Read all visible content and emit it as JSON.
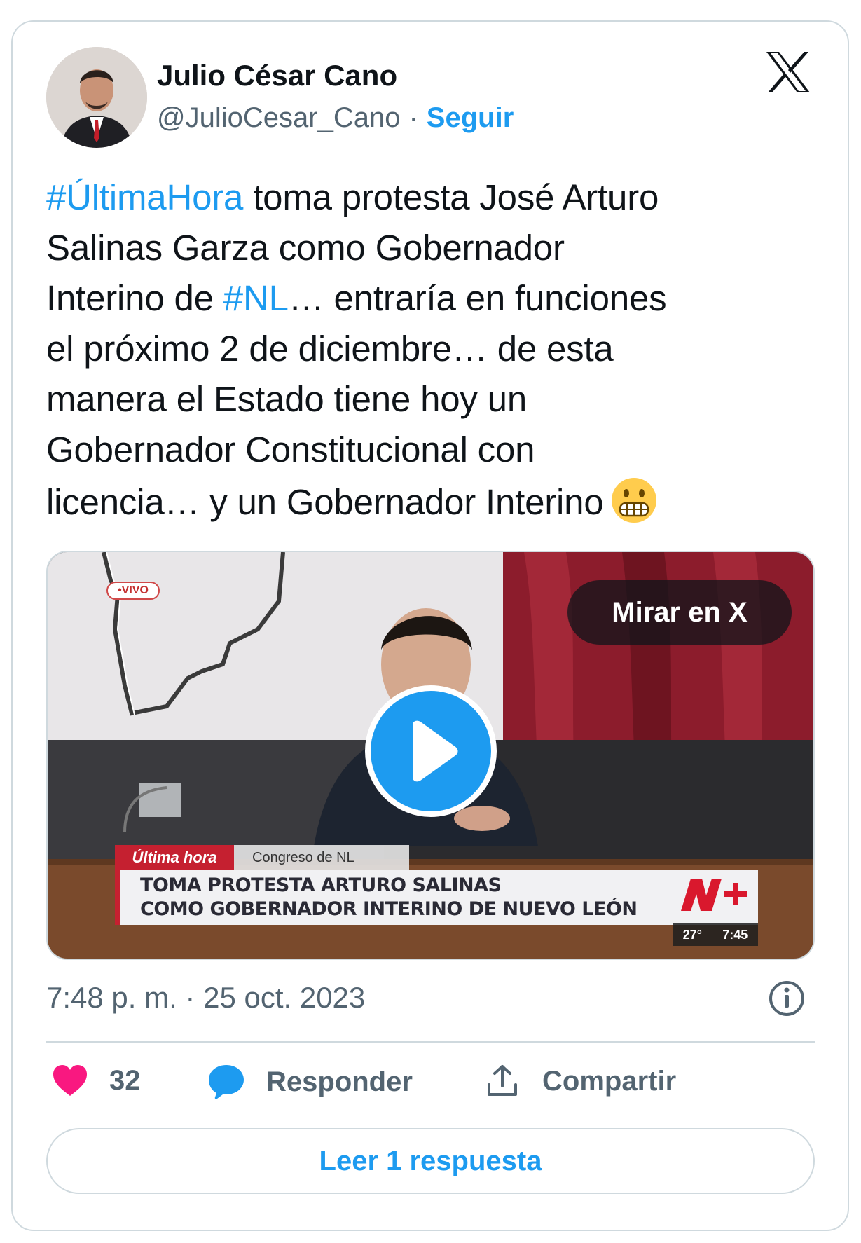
{
  "author": {
    "name": "Julio César Cano",
    "handle": "@JulioCesar_Cano",
    "separator": "·",
    "follow_label": "Seguir"
  },
  "tweet": {
    "lines": [
      {
        "parts": [
          {
            "text": "#ÚltimaHora",
            "hashtag": true
          },
          {
            "text": " toma protesta José Arturo",
            "hashtag": false
          }
        ]
      },
      {
        "parts": [
          {
            "text": "Salinas Garza como Gobernador",
            "hashtag": false
          }
        ]
      },
      {
        "parts": [
          {
            "text": "Interino de ",
            "hashtag": false
          },
          {
            "text": "#NL",
            "hashtag": true
          },
          {
            "text": "… entraría en funciones",
            "hashtag": false
          }
        ]
      },
      {
        "parts": [
          {
            "text": "el próximo 2 de diciembre… de esta",
            "hashtag": false
          }
        ]
      },
      {
        "parts": [
          {
            "text": "manera el Estado tiene hoy un",
            "hashtag": false
          }
        ]
      },
      {
        "parts": [
          {
            "text": "Gobernador Constitucional con",
            "hashtag": false
          }
        ]
      },
      {
        "parts": [
          {
            "text": "licencia… y un Gobernador Interino",
            "hashtag": false
          }
        ]
      }
    ],
    "emoji": "grimacing-face-emoji"
  },
  "media": {
    "live_badge": "•VIVO",
    "watch_label": "Mirar en X",
    "lower_third": {
      "tag": "Última hora",
      "place": "Congreso de NL",
      "line1": "TOMA PROTESTA ARTURO SALINAS",
      "line2": "COMO GOBERNADOR INTERINO DE NUEVO LEÓN",
      "temperature": "27°",
      "time": "7:45"
    }
  },
  "timestamp": "7:48 p. m. · 25 oct. 2023",
  "actions": {
    "likes": "32",
    "reply_label": "Responder",
    "share_label": "Compartir"
  },
  "read_replies_label": "Leer 1 respuesta",
  "colors": {
    "accent": "#1d9bf0",
    "text": "#0f1419",
    "muted": "#536471",
    "heart": "#f91880",
    "border": "#cfd9de"
  }
}
